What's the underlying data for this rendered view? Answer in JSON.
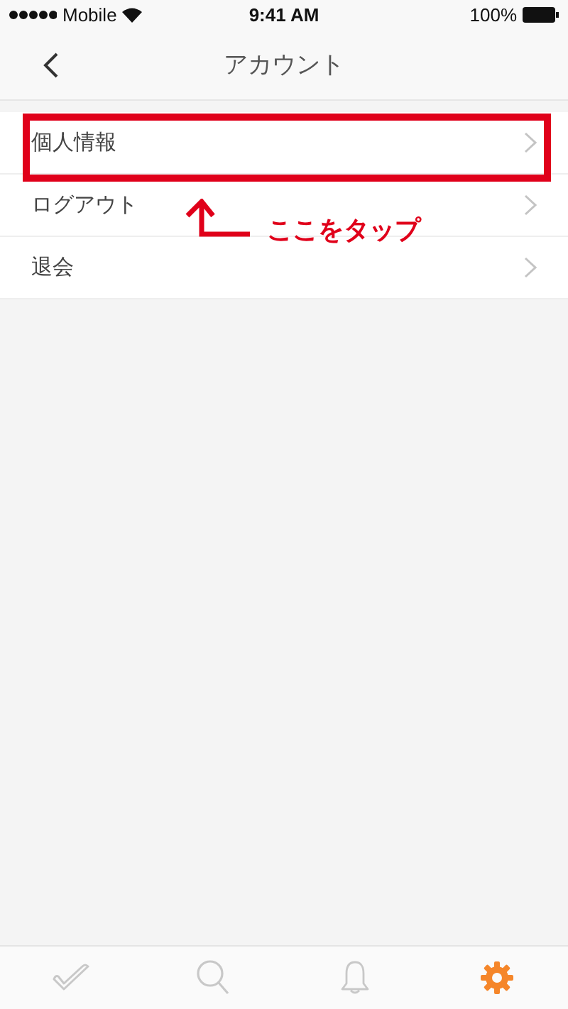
{
  "status_bar": {
    "carrier": "Mobile",
    "time": "9:41 AM",
    "battery": "100%"
  },
  "nav": {
    "title": "アカウント"
  },
  "rows": [
    {
      "label": "個人情報",
      "highlighted": true
    },
    {
      "label": "ログアウト",
      "highlighted": false
    },
    {
      "label": "退会",
      "highlighted": false
    }
  ],
  "annotation": {
    "caption": "ここをタップ"
  },
  "tab_bar": [
    {
      "kind": "check",
      "selected": false
    },
    {
      "kind": "search",
      "selected": false
    },
    {
      "kind": "bell",
      "selected": false
    },
    {
      "kind": "gear",
      "selected": true
    }
  ]
}
